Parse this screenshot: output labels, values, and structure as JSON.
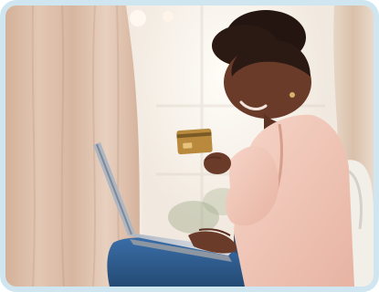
{
  "image": {
    "subject": "person-with-laptop-and-credit-card",
    "colors": {
      "frame_border": "#cfe6f0",
      "curtain": "#d9b9a6",
      "window_glow": "#f7f3ec",
      "skin": "#6b3b2a",
      "blazer": "#f0c7b8",
      "jeans": "#2f5f94",
      "laptop": "#c9ced6",
      "card": "#b9893d"
    }
  }
}
